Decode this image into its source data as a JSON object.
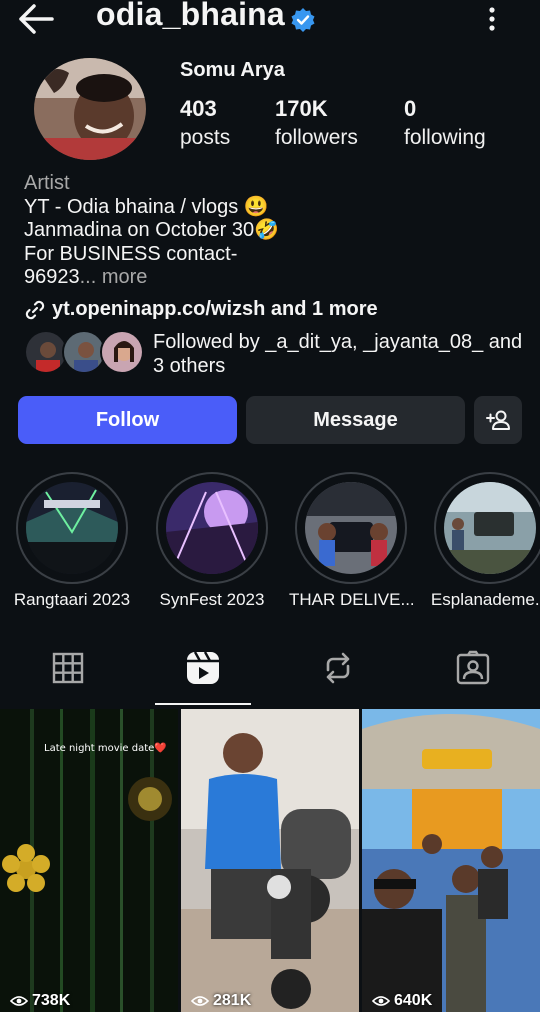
{
  "header": {
    "username": "odia_bhaina",
    "back_icon": "arrow-left-icon",
    "verified_icon": "verified-badge-icon",
    "menu_icon": "more-vertical-icon"
  },
  "profile": {
    "full_name": "Somu Arya",
    "stats": [
      {
        "value": "403",
        "label": "posts"
      },
      {
        "value": "170K",
        "label": "followers"
      },
      {
        "value": "0",
        "label": "following"
      }
    ],
    "category": "Artist",
    "bio_lines": [
      "YT - Odia bhaina / vlogs 😃",
      "Janmadina on October 30🤣",
      "For BUSINESS contact-",
      "96923"
    ],
    "bio_more": "... more",
    "link": "yt.openinapp.co/wizsh and 1 more",
    "followed_by": "Followed by _a_dit_ya, _jayanta_08_ and 3 others"
  },
  "actions": {
    "follow": "Follow",
    "message": "Message",
    "add_user_icon": "add-user-icon"
  },
  "highlights": [
    {
      "label": "Rangtaari 2023"
    },
    {
      "label": "SynFest 2023"
    },
    {
      "label": "THAR DELIVE..."
    },
    {
      "label": "Esplanademe..."
    }
  ],
  "tabs": [
    {
      "icon": "grid-icon"
    },
    {
      "icon": "reels-icon",
      "active": true
    },
    {
      "icon": "repost-icon"
    },
    {
      "icon": "tagged-icon"
    }
  ],
  "reels": [
    {
      "views": "738K",
      "caption": "Late night movie date❤️"
    },
    {
      "views": "281K"
    },
    {
      "views": "640K"
    }
  ],
  "colors": {
    "background": "#0c1014",
    "follow_button": "#4a5df9",
    "secondary_button": "#25292e",
    "verified": "#3897f0",
    "muted_text": "#a8a8a8"
  }
}
